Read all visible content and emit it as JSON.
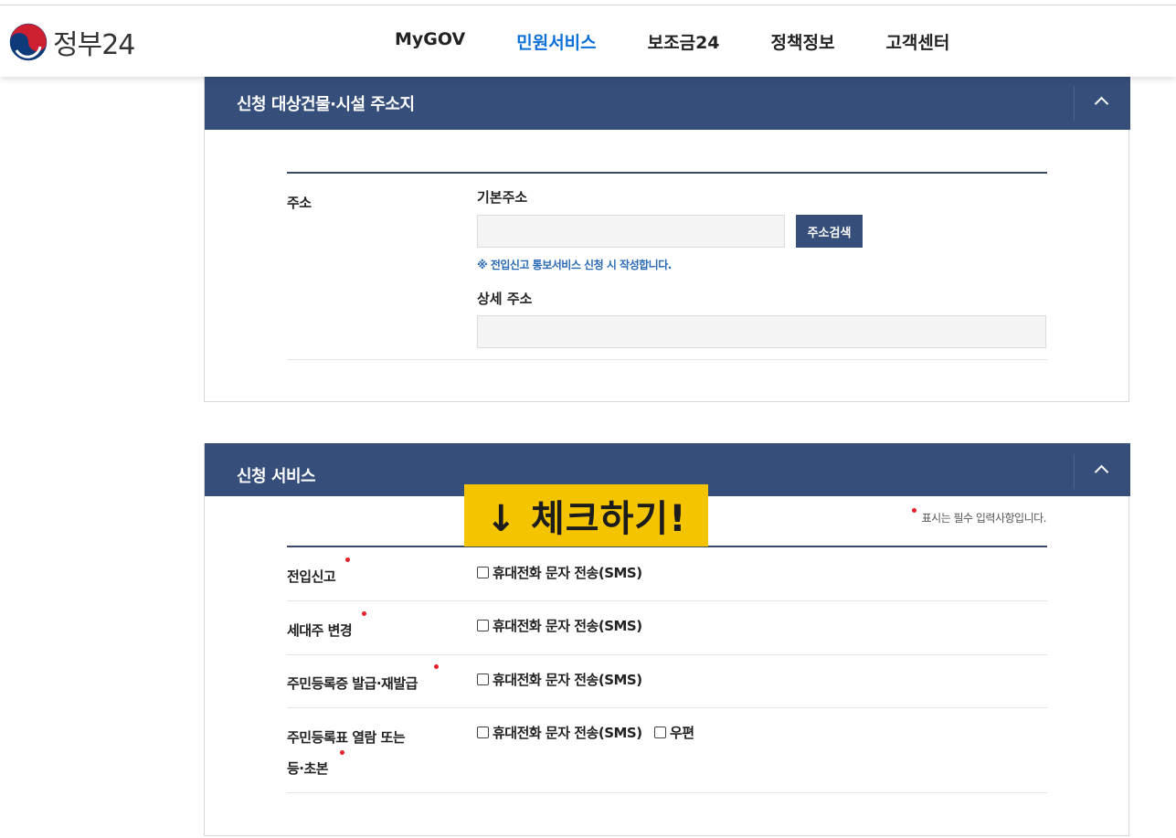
{
  "header": {
    "logo_text": "정부24",
    "nav": [
      "MyGOV",
      "민원서비스",
      "보조금24",
      "정책정보",
      "고객센터"
    ],
    "active_index": 1,
    "active_color": "#0b6fd9"
  },
  "address_section": {
    "title": "신청 대상건물·시설 주소지",
    "row_label": "주소",
    "basic_label": "기본주소",
    "basic_value": "",
    "search_button": "주소검색",
    "notice": "※ 전입신고 통보서비스 신청 시 작성합니다.",
    "detail_label": "상세 주소",
    "detail_value": ""
  },
  "service_section": {
    "title": "신청 서비스",
    "required_note": "표시는 필수 입력사항입니다.",
    "rows": [
      {
        "label": "전입신고",
        "option": "휴대전화 문자 전송(SMS)"
      },
      {
        "label": "세대주 변경",
        "option": "휴대전화 문자 전송(SMS)"
      },
      {
        "label": "주민등록증 발급·재발급",
        "option": "휴대전화 문자 전송(SMS)"
      },
      {
        "label_line1": "주민등록표 열람 또는",
        "label_line2": "등·초본",
        "option": "휴대전화 문자 전송(SMS)",
        "option2": "우편"
      }
    ]
  },
  "overlay": {
    "text": "↓ 체크하기!"
  },
  "colors": {
    "section_header": "#354f7a",
    "banner": "#f5c400",
    "required_dot": "#e8202a",
    "notice": "#2a6ab4"
  }
}
